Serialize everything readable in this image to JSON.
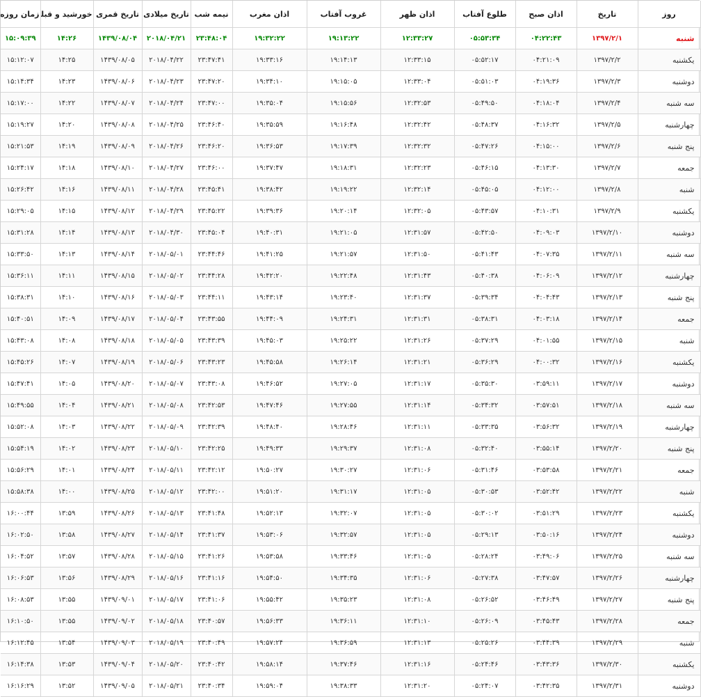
{
  "headers": [
    "روز",
    "تاریخ",
    "اذان صبح",
    "طلوع آفتاب",
    "اذان ظهر",
    "غروب آفتاب",
    "اذان مغرب",
    "نیمه شب",
    "تاریخ میلادی",
    "تاریخ قمری",
    "خورشید و قبله",
    "زمان روزه"
  ],
  "colors": {
    "highlight_day": "#e0191c",
    "highlight_values": "#0b8a0b"
  },
  "rows": [
    [
      "شنبه",
      "۱۳۹۷/۲/۱",
      "۰۴:۲۲:۴۳",
      "۰۵:۵۳:۳۴",
      "۱۲:۳۳:۲۷",
      "۱۹:۱۳:۲۲",
      "۱۹:۳۲:۲۲",
      "۲۳:۴۸:۰۴",
      "۲۰۱۸/۰۴/۲۱",
      "۱۴۳۹/۰۸/۰۴",
      "۱۴:۲۶",
      "۱۵:۰۹:۳۹"
    ],
    [
      "یکشنبه",
      "۱۳۹۷/۲/۲",
      "۰۴:۲۱:۰۹",
      "۰۵:۵۲:۱۷",
      "۱۲:۳۳:۱۵",
      "۱۹:۱۴:۱۳",
      "۱۹:۳۳:۱۶",
      "۲۳:۴۷:۴۱",
      "۲۰۱۸/۰۴/۲۲",
      "۱۴۳۹/۰۸/۰۵",
      "۱۴:۲۵",
      "۱۵:۱۲:۰۷"
    ],
    [
      "دوشنبه",
      "۱۳۹۷/۲/۳",
      "۰۴:۱۹:۳۶",
      "۰۵:۵۱:۰۳",
      "۱۲:۳۳:۰۴",
      "۱۹:۱۵:۰۵",
      "۱۹:۳۴:۱۰",
      "۲۳:۴۷:۲۰",
      "۲۰۱۸/۰۴/۲۳",
      "۱۴۳۹/۰۸/۰۶",
      "۱۴:۲۳",
      "۱۵:۱۴:۳۴"
    ],
    [
      "سه شنبه",
      "۱۳۹۷/۲/۴",
      "۰۴:۱۸:۰۴",
      "۰۵:۴۹:۵۰",
      "۱۲:۳۲:۵۳",
      "۱۹:۱۵:۵۶",
      "۱۹:۳۵:۰۴",
      "۲۳:۴۷:۰۰",
      "۲۰۱۸/۰۴/۲۴",
      "۱۴۳۹/۰۸/۰۷",
      "۱۴:۲۲",
      "۱۵:۱۷:۰۰"
    ],
    [
      "چهارشنبه",
      "۱۳۹۷/۲/۵",
      "۰۴:۱۶:۳۲",
      "۰۵:۴۸:۳۷",
      "۱۲:۳۲:۴۲",
      "۱۹:۱۶:۴۸",
      "۱۹:۳۵:۵۹",
      "۲۳:۴۶:۴۰",
      "۲۰۱۸/۰۴/۲۵",
      "۱۴۳۹/۰۸/۰۸",
      "۱۴:۲۰",
      "۱۵:۱۹:۲۷"
    ],
    [
      "پنج شنبه",
      "۱۳۹۷/۲/۶",
      "۰۴:۱۵:۰۰",
      "۰۵:۴۷:۲۶",
      "۱۲:۳۲:۳۲",
      "۱۹:۱۷:۳۹",
      "۱۹:۳۶:۵۳",
      "۲۳:۴۶:۲۰",
      "۲۰۱۸/۰۴/۲۶",
      "۱۴۳۹/۰۸/۰۹",
      "۱۴:۱۹",
      "۱۵:۲۱:۵۳"
    ],
    [
      "جمعه",
      "۱۳۹۷/۲/۷",
      "۰۴:۱۳:۳۰",
      "۰۵:۴۶:۱۵",
      "۱۲:۳۲:۲۳",
      "۱۹:۱۸:۳۱",
      "۱۹:۳۷:۴۷",
      "۲۳:۴۶:۰۰",
      "۲۰۱۸/۰۴/۲۷",
      "۱۴۳۹/۰۸/۱۰",
      "۱۴:۱۸",
      "۱۵:۲۴:۱۷"
    ],
    [
      "شنبه",
      "۱۳۹۷/۲/۸",
      "۰۴:۱۲:۰۰",
      "۰۵:۴۵:۰۵",
      "۱۲:۳۲:۱۴",
      "۱۹:۱۹:۲۲",
      "۱۹:۳۸:۴۲",
      "۲۳:۴۵:۴۱",
      "۲۰۱۸/۰۴/۲۸",
      "۱۴۳۹/۰۸/۱۱",
      "۱۴:۱۶",
      "۱۵:۲۶:۴۲"
    ],
    [
      "یکشنبه",
      "۱۳۹۷/۲/۹",
      "۰۴:۱۰:۳۱",
      "۰۵:۴۳:۵۷",
      "۱۲:۳۲:۰۵",
      "۱۹:۲۰:۱۴",
      "۱۹:۳۹:۳۶",
      "۲۳:۴۵:۲۲",
      "۲۰۱۸/۰۴/۲۹",
      "۱۴۳۹/۰۸/۱۲",
      "۱۴:۱۵",
      "۱۵:۲۹:۰۵"
    ],
    [
      "دوشنبه",
      "۱۳۹۷/۲/۱۰",
      "۰۴:۰۹:۰۳",
      "۰۵:۴۲:۵۰",
      "۱۲:۳۱:۵۷",
      "۱۹:۲۱:۰۵",
      "۱۹:۴۰:۳۱",
      "۲۳:۴۵:۰۴",
      "۲۰۱۸/۰۴/۳۰",
      "۱۴۳۹/۰۸/۱۳",
      "۱۴:۱۴",
      "۱۵:۳۱:۲۸"
    ],
    [
      "سه شنبه",
      "۱۳۹۷/۲/۱۱",
      "۰۴:۰۷:۳۵",
      "۰۵:۴۱:۴۳",
      "۱۲:۳۱:۵۰",
      "۱۹:۲۱:۵۷",
      "۱۹:۴۱:۲۵",
      "۲۳:۴۴:۴۶",
      "۲۰۱۸/۰۵/۰۱",
      "۱۴۳۹/۰۸/۱۴",
      "۱۴:۱۳",
      "۱۵:۳۳:۵۰"
    ],
    [
      "چهارشنبه",
      "۱۳۹۷/۲/۱۲",
      "۰۴:۰۶:۰۹",
      "۰۵:۴۰:۳۸",
      "۱۲:۳۱:۴۳",
      "۱۹:۲۲:۴۸",
      "۱۹:۴۲:۲۰",
      "۲۳:۴۴:۲۸",
      "۲۰۱۸/۰۵/۰۲",
      "۱۴۳۹/۰۸/۱۵",
      "۱۴:۱۱",
      "۱۵:۳۶:۱۱"
    ],
    [
      "پنج شنبه",
      "۱۳۹۷/۲/۱۳",
      "۰۴:۰۴:۴۳",
      "۰۵:۳۹:۳۴",
      "۱۲:۳۱:۳۷",
      "۱۹:۲۳:۴۰",
      "۱۹:۴۳:۱۴",
      "۲۳:۴۴:۱۱",
      "۲۰۱۸/۰۵/۰۳",
      "۱۴۳۹/۰۸/۱۶",
      "۱۴:۱۰",
      "۱۵:۳۸:۳۱"
    ],
    [
      "جمعه",
      "۱۳۹۷/۲/۱۴",
      "۰۴:۰۳:۱۸",
      "۰۵:۳۸:۳۱",
      "۱۲:۳۱:۳۱",
      "۱۹:۲۴:۳۱",
      "۱۹:۴۴:۰۹",
      "۲۳:۴۳:۵۵",
      "۲۰۱۸/۰۵/۰۴",
      "۱۴۳۹/۰۸/۱۷",
      "۱۴:۰۹",
      "۱۵:۴۰:۵۱"
    ],
    [
      "شنبه",
      "۱۳۹۷/۲/۱۵",
      "۰۴:۰۱:۵۵",
      "۰۵:۳۷:۲۹",
      "۱۲:۳۱:۲۶",
      "۱۹:۲۵:۲۲",
      "۱۹:۴۵:۰۳",
      "۲۳:۴۳:۳۹",
      "۲۰۱۸/۰۵/۰۵",
      "۱۴۳۹/۰۸/۱۸",
      "۱۴:۰۸",
      "۱۵:۴۳:۰۸"
    ],
    [
      "یکشنبه",
      "۱۳۹۷/۲/۱۶",
      "۰۴:۰۰:۳۲",
      "۰۵:۳۶:۲۹",
      "۱۲:۳۱:۲۱",
      "۱۹:۲۶:۱۴",
      "۱۹:۴۵:۵۸",
      "۲۳:۴۳:۲۳",
      "۲۰۱۸/۰۵/۰۶",
      "۱۴۳۹/۰۸/۱۹",
      "۱۴:۰۷",
      "۱۵:۴۵:۲۶"
    ],
    [
      "دوشنبه",
      "۱۳۹۷/۲/۱۷",
      "۰۳:۵۹:۱۱",
      "۰۵:۳۵:۳۰",
      "۱۲:۳۱:۱۷",
      "۱۹:۲۷:۰۵",
      "۱۹:۴۶:۵۲",
      "۲۳:۴۳:۰۸",
      "۲۰۱۸/۰۵/۰۷",
      "۱۴۳۹/۰۸/۲۰",
      "۱۴:۰۵",
      "۱۵:۴۷:۴۱"
    ],
    [
      "سه شنبه",
      "۱۳۹۷/۲/۱۸",
      "۰۳:۵۷:۵۱",
      "۰۵:۳۴:۳۲",
      "۱۲:۳۱:۱۴",
      "۱۹:۲۷:۵۵",
      "۱۹:۴۷:۴۶",
      "۲۳:۴۲:۵۳",
      "۲۰۱۸/۰۵/۰۸",
      "۱۴۳۹/۰۸/۲۱",
      "۱۴:۰۴",
      "۱۵:۴۹:۵۵"
    ],
    [
      "چهارشنبه",
      "۱۳۹۷/۲/۱۹",
      "۰۳:۵۶:۳۲",
      "۰۵:۳۳:۳۵",
      "۱۲:۳۱:۱۱",
      "۱۹:۲۸:۴۶",
      "۱۹:۴۸:۴۰",
      "۲۳:۴۲:۳۹",
      "۲۰۱۸/۰۵/۰۹",
      "۱۴۳۹/۰۸/۲۲",
      "۱۴:۰۳",
      "۱۵:۵۲:۰۸"
    ],
    [
      "پنج شنبه",
      "۱۳۹۷/۲/۲۰",
      "۰۳:۵۵:۱۴",
      "۰۵:۳۲:۴۰",
      "۱۲:۳۱:۰۸",
      "۱۹:۲۹:۳۷",
      "۱۹:۴۹:۳۳",
      "۲۳:۴۲:۲۵",
      "۲۰۱۸/۰۵/۱۰",
      "۱۴۳۹/۰۸/۲۳",
      "۱۴:۰۲",
      "۱۵:۵۴:۱۹"
    ],
    [
      "جمعه",
      "۱۳۹۷/۲/۲۱",
      "۰۳:۵۳:۵۸",
      "۰۵:۳۱:۴۶",
      "۱۲:۳۱:۰۶",
      "۱۹:۳۰:۲۷",
      "۱۹:۵۰:۲۷",
      "۲۳:۴۲:۱۲",
      "۲۰۱۸/۰۵/۱۱",
      "۱۴۳۹/۰۸/۲۴",
      "۱۴:۰۱",
      "۱۵:۵۶:۲۹"
    ],
    [
      "شنبه",
      "۱۳۹۷/۲/۲۲",
      "۰۳:۵۲:۴۲",
      "۰۵:۳۰:۵۳",
      "۱۲:۳۱:۰۵",
      "۱۹:۳۱:۱۷",
      "۱۹:۵۱:۲۰",
      "۲۳:۴۲:۰۰",
      "۲۰۱۸/۰۵/۱۲",
      "۱۴۳۹/۰۸/۲۵",
      "۱۴:۰۰",
      "۱۵:۵۸:۳۸"
    ],
    [
      "یکشنبه",
      "۱۳۹۷/۲/۲۳",
      "۰۳:۵۱:۲۹",
      "۰۵:۳۰:۰۲",
      "۱۲:۳۱:۰۵",
      "۱۹:۳۲:۰۷",
      "۱۹:۵۲:۱۳",
      "۲۳:۴۱:۴۸",
      "۲۰۱۸/۰۵/۱۳",
      "۱۴۳۹/۰۸/۲۶",
      "۱۳:۵۹",
      "۱۶:۰۰:۴۴"
    ],
    [
      "دوشنبه",
      "۱۳۹۷/۲/۲۴",
      "۰۳:۵۰:۱۶",
      "۰۵:۲۹:۱۳",
      "۱۲:۳۱:۰۵",
      "۱۹:۳۲:۵۷",
      "۱۹:۵۳:۰۶",
      "۲۳:۴۱:۳۷",
      "۲۰۱۸/۰۵/۱۴",
      "۱۴۳۹/۰۸/۲۷",
      "۱۳:۵۸",
      "۱۶:۰۲:۵۰"
    ],
    [
      "سه شنبه",
      "۱۳۹۷/۲/۲۵",
      "۰۳:۴۹:۰۶",
      "۰۵:۲۸:۲۴",
      "۱۲:۳۱:۰۵",
      "۱۹:۳۳:۴۶",
      "۱۹:۵۳:۵۸",
      "۲۳:۴۱:۲۶",
      "۲۰۱۸/۰۵/۱۵",
      "۱۴۳۹/۰۸/۲۸",
      "۱۳:۵۷",
      "۱۶:۰۴:۵۲"
    ],
    [
      "چهارشنبه",
      "۱۳۹۷/۲/۲۶",
      "۰۳:۴۷:۵۷",
      "۰۵:۲۷:۳۸",
      "۱۲:۳۱:۰۶",
      "۱۹:۳۴:۳۵",
      "۱۹:۵۴:۵۰",
      "۲۳:۴۱:۱۶",
      "۲۰۱۸/۰۵/۱۶",
      "۱۴۳۹/۰۸/۲۹",
      "۱۳:۵۶",
      "۱۶:۰۶:۵۳"
    ],
    [
      "پنج شنبه",
      "۱۳۹۷/۲/۲۷",
      "۰۳:۴۶:۴۹",
      "۰۵:۲۶:۵۲",
      "۱۲:۳۱:۰۸",
      "۱۹:۳۵:۲۳",
      "۱۹:۵۵:۴۲",
      "۲۳:۴۱:۰۶",
      "۲۰۱۸/۰۵/۱۷",
      "۱۴۳۹/۰۹/۰۱",
      "۱۳:۵۵",
      "۱۶:۰۸:۵۳"
    ],
    [
      "جمعه",
      "۱۳۹۷/۲/۲۸",
      "۰۳:۴۵:۴۳",
      "۰۵:۲۶:۰۹",
      "۱۲:۳۱:۱۰",
      "۱۹:۳۶:۱۱",
      "۱۹:۵۶:۳۳",
      "۲۳:۴۰:۵۷",
      "۲۰۱۸/۰۵/۱۸",
      "۱۴۳۹/۰۹/۰۲",
      "۱۳:۵۵",
      "۱۶:۱۰:۵۰"
    ],
    [
      "شنبه",
      "۱۳۹۷/۲/۲۹",
      "۰۳:۴۴:۳۹",
      "۰۵:۲۵:۲۶",
      "۱۲:۳۱:۱۳",
      "۱۹:۳۶:۵۹",
      "۱۹:۵۷:۲۴",
      "۲۳:۴۰:۴۹",
      "۲۰۱۸/۰۵/۱۹",
      "۱۴۳۹/۰۹/۰۳",
      "۱۳:۵۴",
      "۱۶:۱۲:۴۵"
    ],
    [
      "یکشنبه",
      "۱۳۹۷/۲/۳۰",
      "۰۳:۴۳:۳۶",
      "۰۵:۲۴:۴۶",
      "۱۲:۳۱:۱۶",
      "۱۹:۳۷:۴۶",
      "۱۹:۵۸:۱۴",
      "۲۳:۴۰:۴۲",
      "۲۰۱۸/۰۵/۲۰",
      "۱۴۳۹/۰۹/۰۴",
      "۱۳:۵۳",
      "۱۶:۱۴:۳۸"
    ],
    [
      "دوشنبه",
      "۱۳۹۷/۲/۳۱",
      "۰۳:۴۲:۳۵",
      "۰۵:۲۴:۰۷",
      "۱۲:۳۱:۲۰",
      "۱۹:۳۸:۳۳",
      "۱۹:۵۹:۰۴",
      "۲۳:۴۰:۳۴",
      "۲۰۱۸/۰۵/۲۱",
      "۱۴۳۹/۰۹/۰۵",
      "۱۳:۵۲",
      "۱۶:۱۶:۲۹"
    ]
  ]
}
